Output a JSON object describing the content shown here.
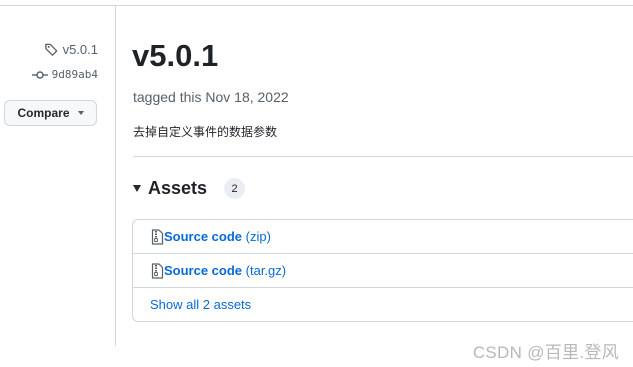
{
  "sidebar": {
    "tag_label": "v5.0.1",
    "commit_sha": "9d89ab4",
    "compare_label": "Compare",
    "tag_icon": "tag-icon",
    "commit_icon": "git-commit-icon"
  },
  "release": {
    "title": "v5.0.1",
    "tagged_text": "tagged this Nov 18, 2022",
    "description": "去掉自定义事件的数据参数"
  },
  "assets": {
    "heading": "Assets",
    "count": "2",
    "items": [
      {
        "name": "Source code",
        "ext": "(zip)",
        "icon": "file-zip-icon"
      },
      {
        "name": "Source code",
        "ext": "(tar.gz)",
        "icon": "file-zip-icon"
      }
    ],
    "show_all": "Show all 2 assets"
  },
  "watermark": "CSDN @百里.登风",
  "colors": {
    "link": "#0969da",
    "muted": "#57606a",
    "border": "#d0d7de",
    "text": "#1f2328"
  }
}
